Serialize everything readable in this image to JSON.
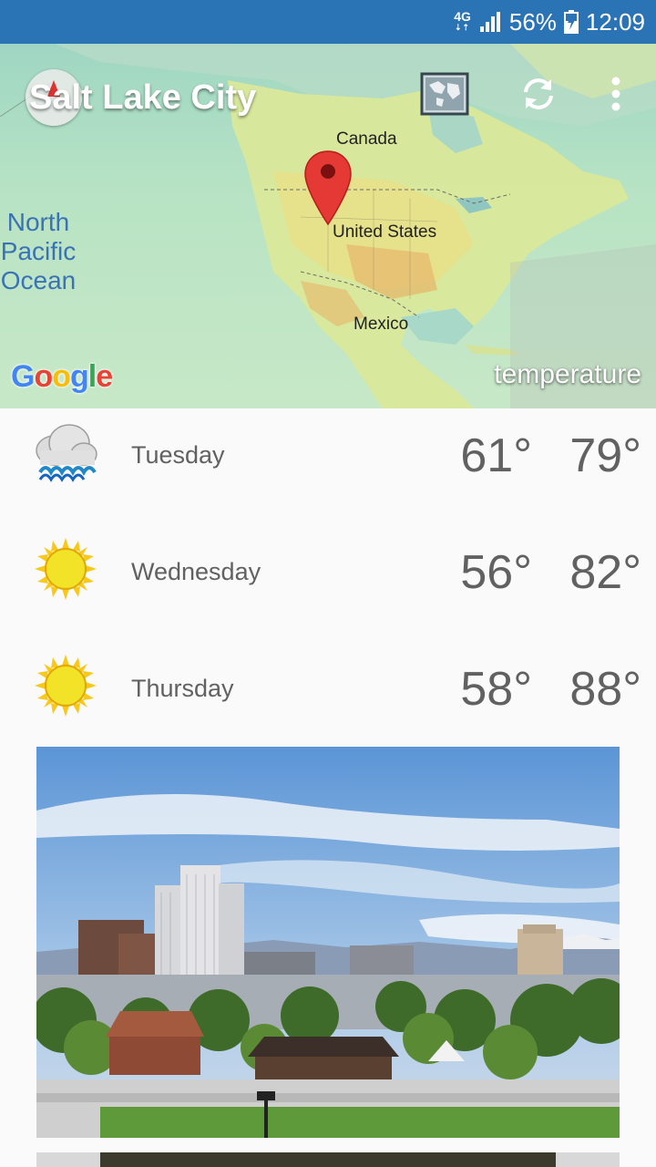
{
  "status_bar": {
    "network": "4G",
    "battery": "56%",
    "time": "12:09"
  },
  "map": {
    "city": "Salt Lake City",
    "labels": {
      "canada": "Canada",
      "united_states": "United States",
      "mexico": "Mexico",
      "ocean": "North Pacific Ocean"
    },
    "google_logo": "Google",
    "overlay": "temperature"
  },
  "forecast": [
    {
      "day": "Tuesday",
      "low": "61°",
      "high": "79°",
      "icon": "rain-cloud-icon"
    },
    {
      "day": "Wednesday",
      "low": "56°",
      "high": "82°",
      "icon": "sun-icon"
    },
    {
      "day": "Thursday",
      "low": "58°",
      "high": "88°",
      "icon": "sun-icon"
    }
  ],
  "colors": {
    "status_bar": "#2a73b5",
    "text": "#616161",
    "marker": "#e53935"
  }
}
